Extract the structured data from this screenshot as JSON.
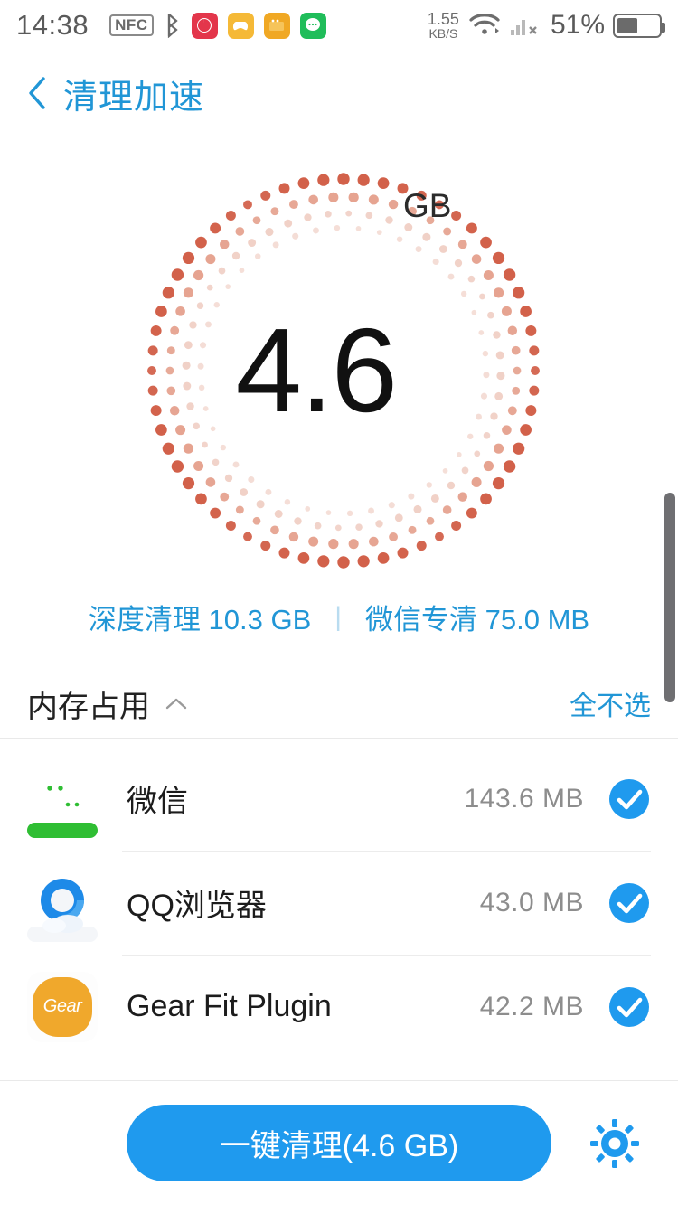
{
  "statusbar": {
    "time": "14:38",
    "nfc_label": "NFC",
    "bluetooth_icon": "bluetooth-icon",
    "tray_icons": [
      "red-app-icon",
      "game-controller-icon",
      "wallet-icon",
      "chat-app-icon"
    ],
    "net_rate_value": "1.55",
    "net_rate_unit": "KB/S",
    "wifi_icon": "wifi-icon",
    "signal_icon": "cellular-signal-icon",
    "battery_percent": "51%",
    "battery_level": 51
  },
  "navbar": {
    "back_icon": "chevron-left-icon",
    "title": "清理加速"
  },
  "dial": {
    "value": "4.6",
    "unit": "GB",
    "ring_color_strong": "#d2614a",
    "ring_color_mid": "#e08f78",
    "ring_color_light": "#ecc3b6"
  },
  "summary": {
    "deep_clean_label": "深度清理 10.3 GB",
    "separator": "|",
    "wechat_clean_label": "微信专清 75.0 MB"
  },
  "section": {
    "title": "内存占用",
    "collapse_icon": "chevron-up-icon",
    "action_label": "全不选"
  },
  "apps": [
    {
      "icon": "wechat-icon",
      "name": "微信",
      "size": "143.6  MB",
      "checked": true
    },
    {
      "icon": "qq-browser-icon",
      "name": "QQ浏览器",
      "size": "43.0  MB",
      "checked": true
    },
    {
      "icon": "gear-fit-icon",
      "icon_text": "Gear",
      "name": "Gear Fit Plugin",
      "size": "42.2  MB",
      "checked": true
    }
  ],
  "bottombar": {
    "clean_button_label": "一键清理(4.6 GB)",
    "settings_icon": "gear-settings-icon",
    "accent_color": "#1f9aee"
  },
  "scrollbar": {
    "present": true
  }
}
